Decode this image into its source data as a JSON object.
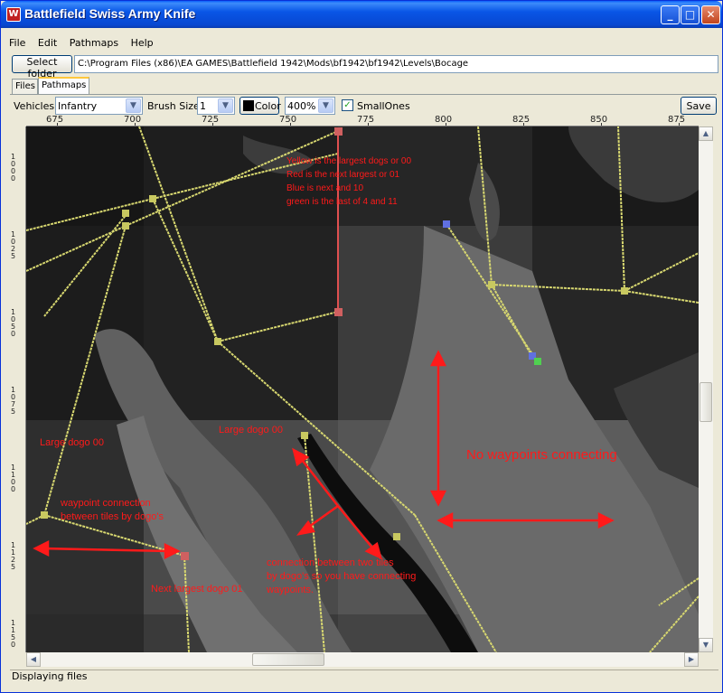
{
  "window": {
    "title": "Battlefield Swiss Army Knife",
    "icon": "app-icon"
  },
  "titlebar_buttons": {
    "minimize": "_",
    "maximize": "□",
    "close": "✕"
  },
  "menu": [
    "File",
    "Edit",
    "Pathmaps",
    "Help"
  ],
  "folder": {
    "button_label": "Select folder",
    "path": "C:\\Program Files (x86)\\EA GAMES\\Battlefield 1942\\Mods\\bf1942\\bf1942\\Levels\\Bocage"
  },
  "tabs": [
    {
      "label": "Files",
      "active": false
    },
    {
      "label": "Pathmaps",
      "active": true
    }
  ],
  "toolbar": {
    "vehicles_label": "Vehicles",
    "vehicles_value": "Infantry",
    "brush_label": "Brush Size",
    "brush_value": "1",
    "color_label": "Color",
    "color_value": "#000000",
    "zoom_value": "400%",
    "smallones_label": "SmallOnes",
    "smallones_checked": true,
    "save_label": "Save"
  },
  "ruler_top": [
    "675",
    "700",
    "725",
    "750",
    "775",
    "800",
    "825",
    "850",
    "875"
  ],
  "ruler_left": [
    [
      "1",
      "0",
      "0",
      "0"
    ],
    [
      "1",
      "0",
      "2",
      "5"
    ],
    [
      "1",
      "0",
      "5",
      "0"
    ],
    [
      "1",
      "0",
      "7",
      "5"
    ],
    [
      "1",
      "1",
      "0",
      "0"
    ],
    [
      "1",
      "1",
      "2",
      "5"
    ],
    [
      "1",
      "1",
      "5",
      "0"
    ]
  ],
  "annotations": {
    "legend": "Yellow is the largest dogs or 00\nRed is the next largest or 01\nBlue is next and 10\ngreen is the last of 4 and 11",
    "large_dogo_left": "Large dogo 00",
    "large_dogo_center": "Large dogo 00",
    "no_waypoints": "No waypoints connecting",
    "waypoint_connection": "waypoint connection\nbetween tiles by dogo's",
    "connection_two_tiles": "connection between two tiles\nby dogo's so you have connecting\nwaypoints.",
    "next_largest": "Next largest dogo 01"
  },
  "colors": {
    "waypoint_yellow": "#d8d870",
    "annotation_red": "#ff1a1a",
    "link_red": "#e05050",
    "blue_node": "#6070e0",
    "green_node": "#50d050"
  },
  "status": "Displaying files"
}
